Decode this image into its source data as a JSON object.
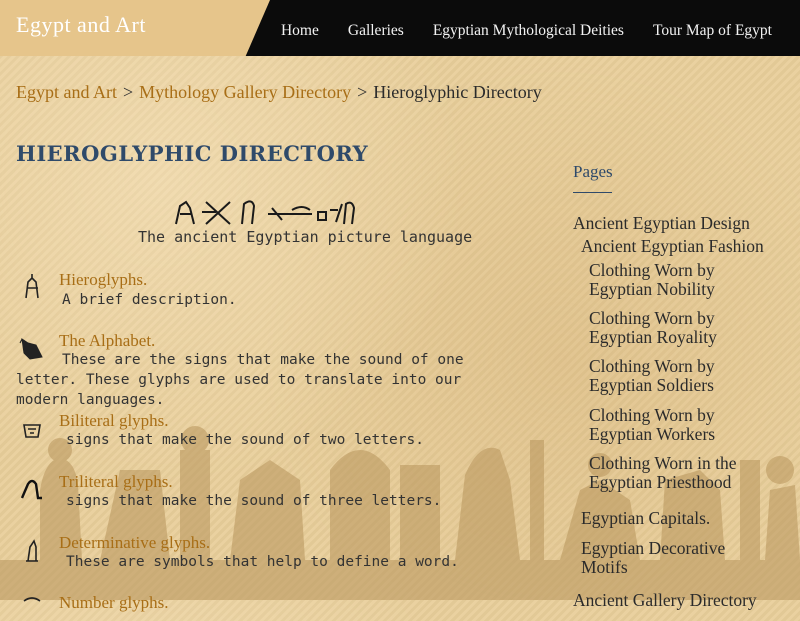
{
  "header": {
    "brand": "Egypt and Art",
    "nav": [
      "Home",
      "Galleries",
      "Egyptian Mythological Deities",
      "Tour Map of Egypt"
    ]
  },
  "breadcrumb": {
    "items": [
      "Egypt and Art",
      "Mythology Gallery Directory"
    ],
    "separator": ">",
    "current": "Hieroglyphic Directory"
  },
  "page_title": "HIEROGLYPHIC DIRECTORY",
  "subtitle": "The ancient Egyptian picture language",
  "entries": [
    {
      "name": "Hieroglyphs.",
      "desc": "A brief description.",
      "icon": "seated-man-glyph-icon"
    },
    {
      "name": "The Alphabet.",
      "desc": "These are the signs that make the sound of one letter. These glyphs are used to translate into our modern languages.",
      "icon": "vulture-glyph-icon"
    },
    {
      "name": "Biliteral glyphs.",
      "desc": "signs that make the sound of two letters.",
      "icon": "basket-glyph-icon"
    },
    {
      "name": "Triliteral glyphs.",
      "desc": "signs that make the sound of three letters.",
      "icon": "ankh-curve-glyph-icon"
    },
    {
      "name": "Determinative glyphs.",
      "desc": "These are symbols that help to define a word.",
      "icon": "seated-figure-glyph-icon"
    },
    {
      "name": "Number glyphs.",
      "desc": "",
      "icon": "number-glyph-icon"
    }
  ],
  "sidebar": {
    "heading": "Pages",
    "items": [
      "Ancient Egyptian Design",
      "Ancient Egyptian Fashion",
      "Clothing Worn by Egyptian Nobility",
      "Clothing Worn by Egyptian Royality",
      "Clothing Worn by Egyptian Soldiers",
      "Clothing Worn by Egyptian Workers",
      "Clothing Worn in the Egyptian Priesthood",
      "Egyptian Capitals.",
      "Egyptian Decorative Motifs",
      "Ancient Gallery Directory"
    ]
  },
  "colors": {
    "link": "#a86e16",
    "title": "#2f4a6a",
    "header": "#0b0b0b",
    "brand_bg": "#e6c58b",
    "page_bg": "#e9cf9b"
  }
}
